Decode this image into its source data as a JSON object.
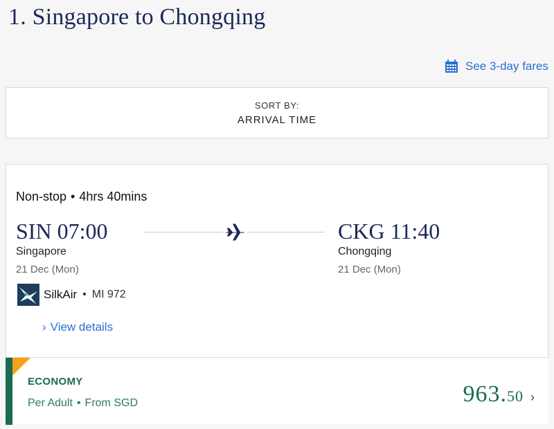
{
  "page": {
    "title": "1. Singapore to Chongqing"
  },
  "fares_link": {
    "label": "See 3-day fares",
    "icon": "calendar-icon"
  },
  "sort": {
    "label": "SORT BY:",
    "value": "ARRIVAL TIME"
  },
  "flight": {
    "stops": "Non-stop",
    "separator": "•",
    "duration": "4hrs 40mins",
    "departure": {
      "time_code": "SIN 07:00",
      "city": "Singapore",
      "date": "21 Dec (Mon)"
    },
    "arrival": {
      "time_code": "CKG 11:40",
      "city": "Chongqing",
      "date": "21 Dec (Mon)"
    },
    "airline": {
      "name": "SilkAir",
      "separator": "•",
      "flight_number": "MI 972"
    },
    "details_link": {
      "chevron": "›",
      "label": "View details"
    }
  },
  "fare": {
    "cabin": "ECONOMY",
    "per": "Per Adult",
    "separator": "•",
    "from": "From SGD",
    "price_main": "963.",
    "price_decimal": "50",
    "chevron": "›"
  },
  "colors": {
    "navy": "#1b2858",
    "link_blue": "#2a6fd6",
    "fare_green": "#1b6b54",
    "flag_orange": "#f2a31b"
  }
}
